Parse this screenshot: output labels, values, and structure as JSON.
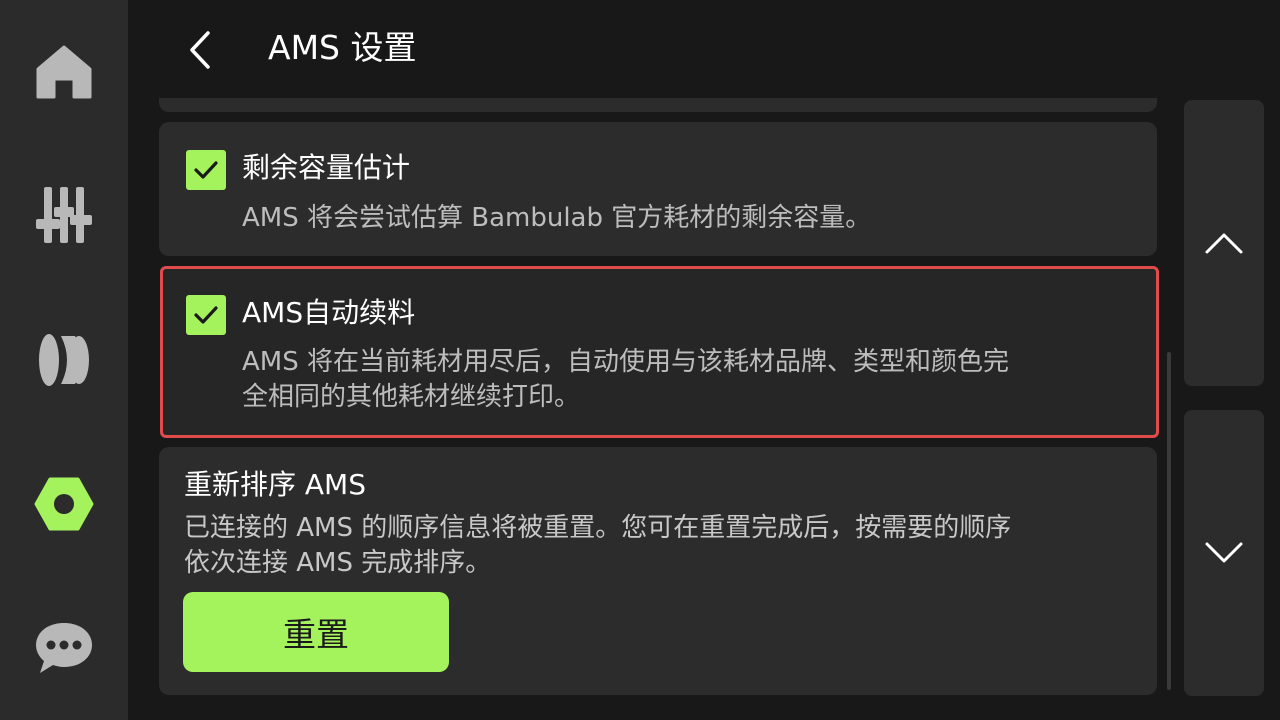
{
  "header": {
    "title": "AMS 设置"
  },
  "nav": {
    "items": [
      {
        "icon": "home-icon"
      },
      {
        "icon": "controls-icon"
      },
      {
        "icon": "filament-icon"
      },
      {
        "icon": "settings-icon",
        "active": true
      },
      {
        "icon": "chat-icon"
      }
    ]
  },
  "settings": {
    "remaining_capacity": {
      "checked": true,
      "title": "剩余容量估计",
      "description": "AMS 将会尝试估算 Bambulab 官方耗材的剩余容量。"
    },
    "auto_refill": {
      "checked": true,
      "title": "AMS自动续料",
      "description_line1": "AMS 将在当前耗材用尽后，自动使用与该耗材品牌、类型和颜色完",
      "description_line2": "全相同的其他耗材继续打印。"
    },
    "reorder": {
      "title": "重新排序 AMS",
      "description_line1": "已连接的 AMS 的顺序信息将被重置。您可在重置完成后，按需要的顺序",
      "description_line2": "依次连接 AMS 完成排序。",
      "button_label": "重置"
    }
  },
  "colors": {
    "accent": "#a5f35c",
    "highlight_border": "#e04b4b",
    "background": "#181818",
    "card": "#2c2c2c"
  }
}
